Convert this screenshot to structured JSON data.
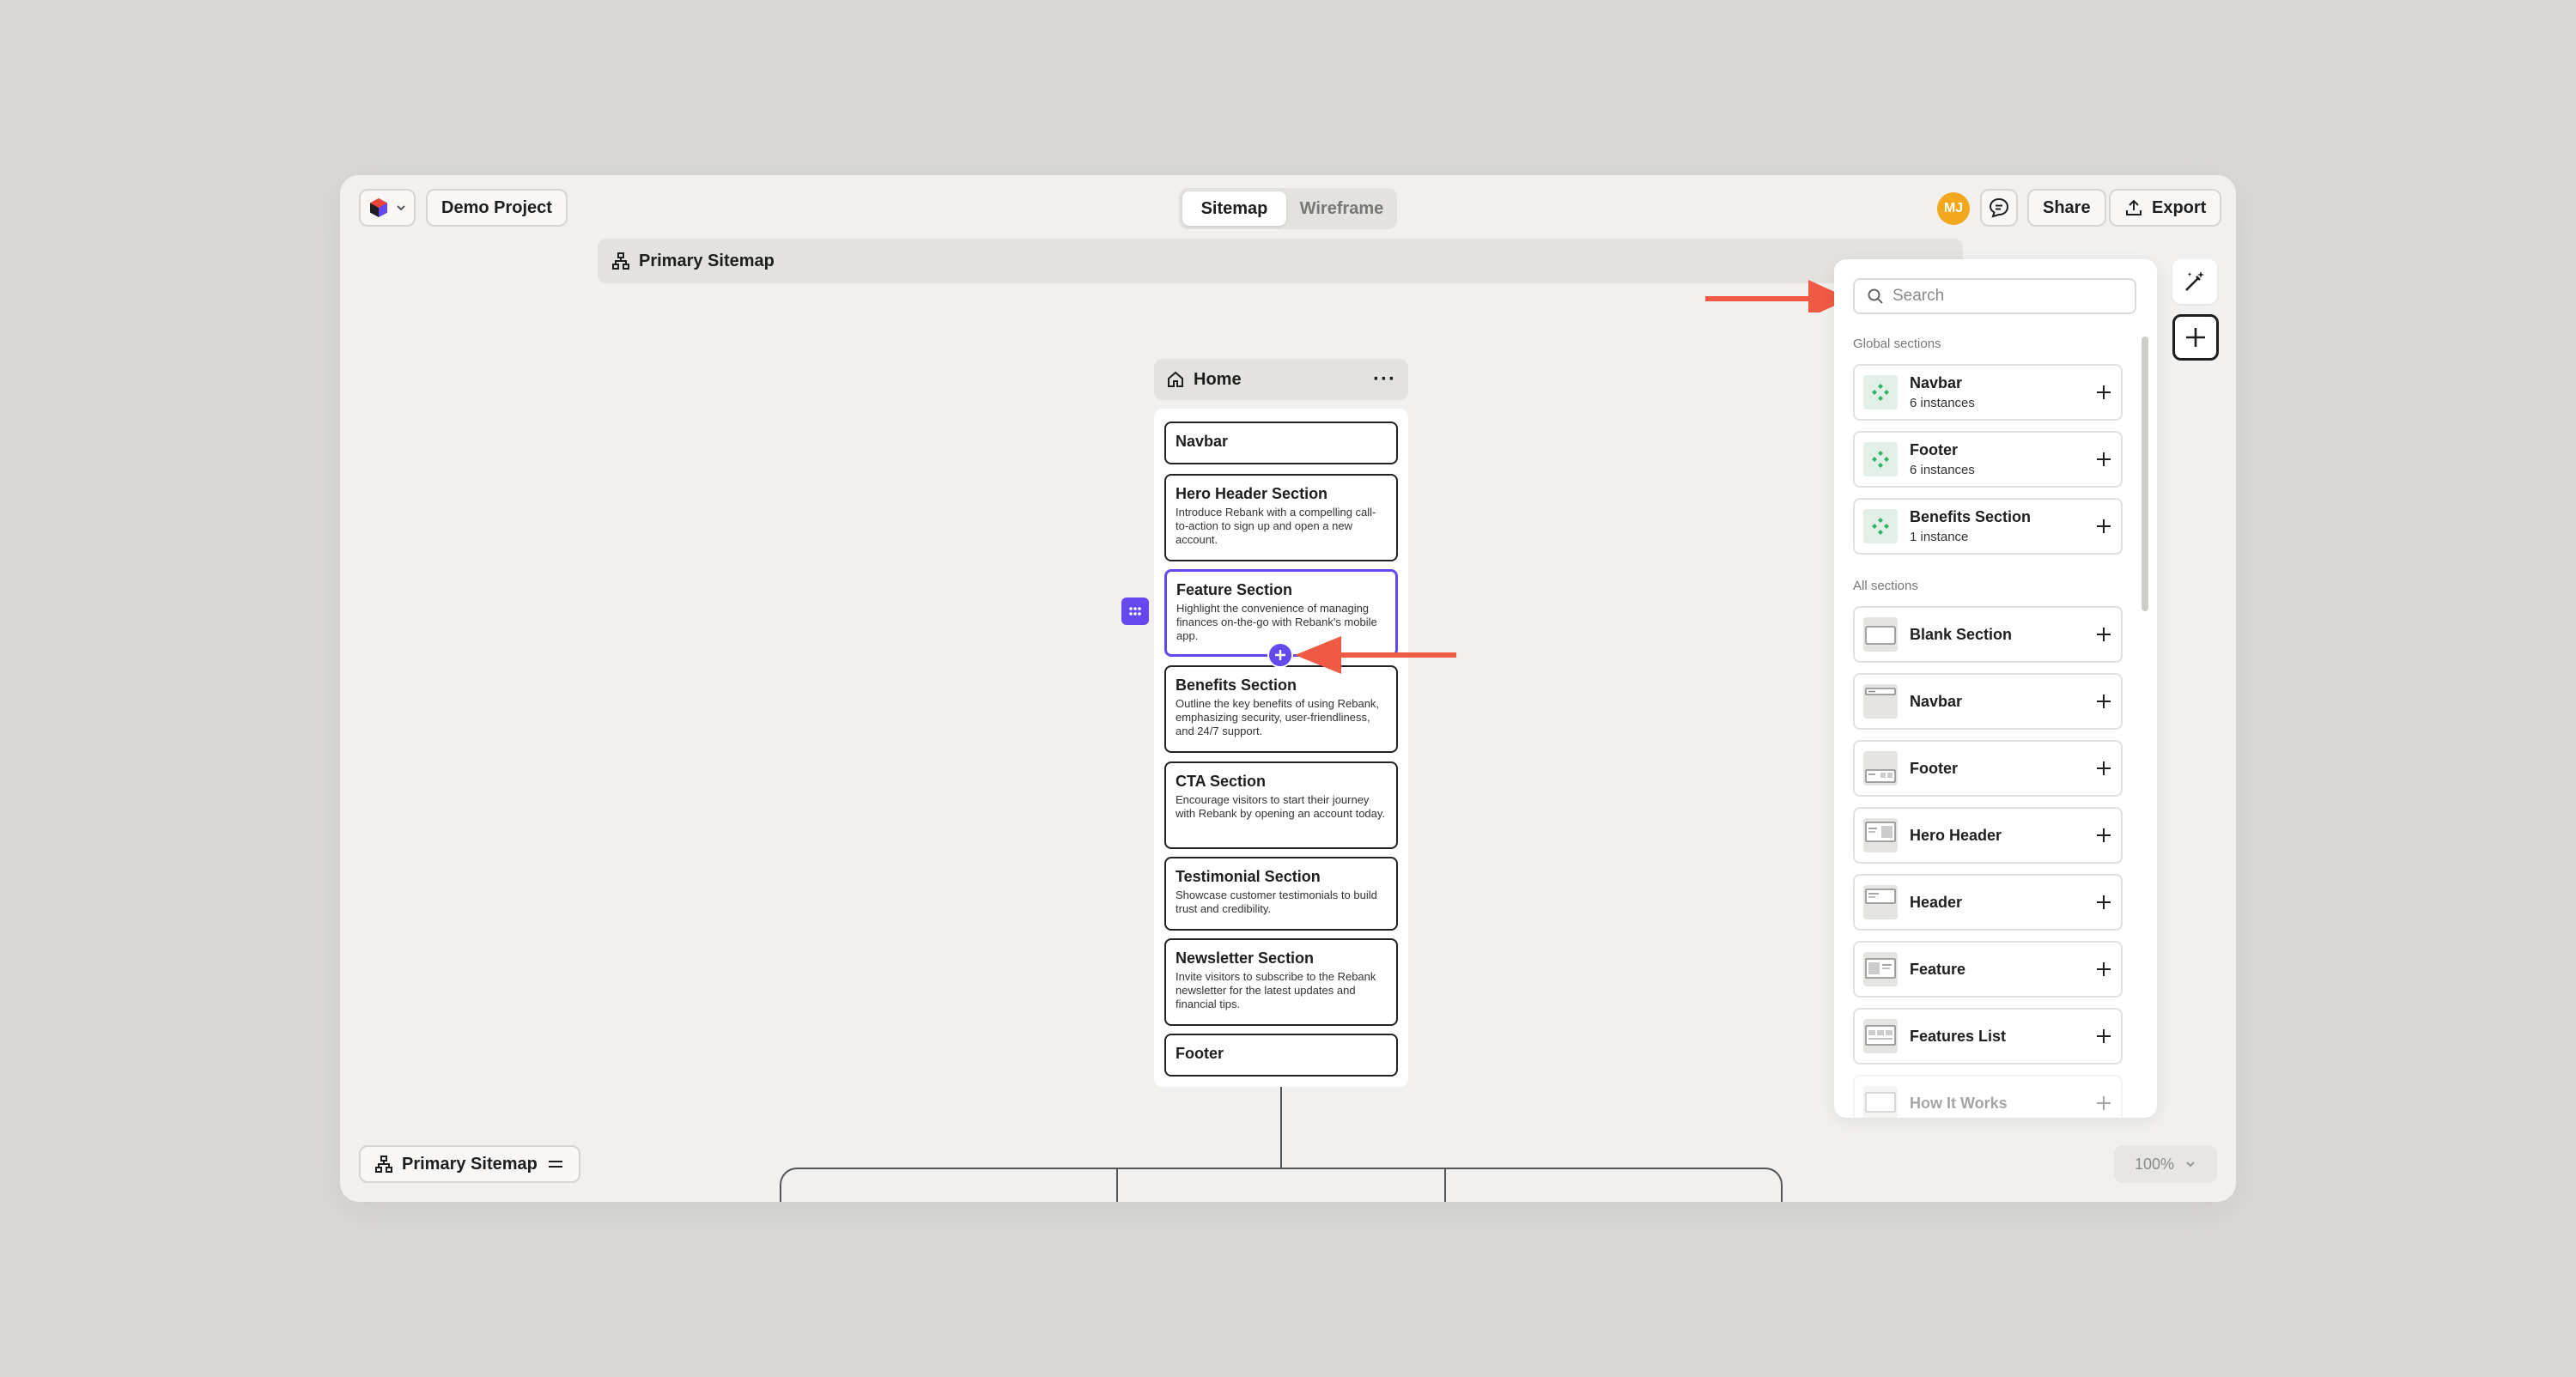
{
  "toolbar": {
    "project_name": "Demo Project",
    "tabs": [
      {
        "label": "Sitemap",
        "active": true
      },
      {
        "label": "Wireframe",
        "active": false
      }
    ],
    "avatar_initials": "MJ",
    "share_label": "Share",
    "export_label": "Export"
  },
  "sitemap_bar": {
    "title": "Primary Sitemap"
  },
  "page": {
    "title": "Home",
    "sections": [
      {
        "title": "Navbar",
        "desc": ""
      },
      {
        "title": "Hero Header Section",
        "desc": "Introduce Rebank with a compelling call-to-action to sign up and open a new account."
      },
      {
        "title": "Feature Section",
        "desc": "Highlight the convenience of managing finances on-the-go with Rebank's mobile app.",
        "selected": true
      },
      {
        "title": "Benefits Section",
        "desc": "Outline the key benefits of using Rebank, emphasizing security, user-friendliness, and 24/7 support."
      },
      {
        "title": "CTA Section",
        "desc": "Encourage visitors to start their journey with Rebank by opening an account today."
      },
      {
        "title": "Testimonial Section",
        "desc": "Showcase customer testimonials to build trust and credibility."
      },
      {
        "title": "Newsletter Section",
        "desc": "Invite visitors to subscribe to the Rebank newsletter for the latest updates and financial tips."
      },
      {
        "title": "Footer",
        "desc": ""
      }
    ]
  },
  "panel": {
    "search_placeholder": "Search",
    "global_label": "Global sections",
    "global_sections": [
      {
        "name": "Navbar",
        "count": "6 instances"
      },
      {
        "name": "Footer",
        "count": "6 instances"
      },
      {
        "name": "Benefits Section",
        "count": "1 instance"
      }
    ],
    "all_label": "All sections",
    "all_sections": [
      {
        "name": "Blank Section"
      },
      {
        "name": "Navbar"
      },
      {
        "name": "Footer"
      },
      {
        "name": "Hero Header"
      },
      {
        "name": "Header"
      },
      {
        "name": "Feature"
      },
      {
        "name": "Features List"
      },
      {
        "name": "How It Works"
      }
    ]
  },
  "bottom": {
    "sitemap_label": "Primary Sitemap",
    "zoom": "100%"
  },
  "colors": {
    "accent": "#6548f0",
    "annotation_arrow": "#ef5a44",
    "avatar": "#f2a81d",
    "global_icon": "#2fb26a"
  }
}
